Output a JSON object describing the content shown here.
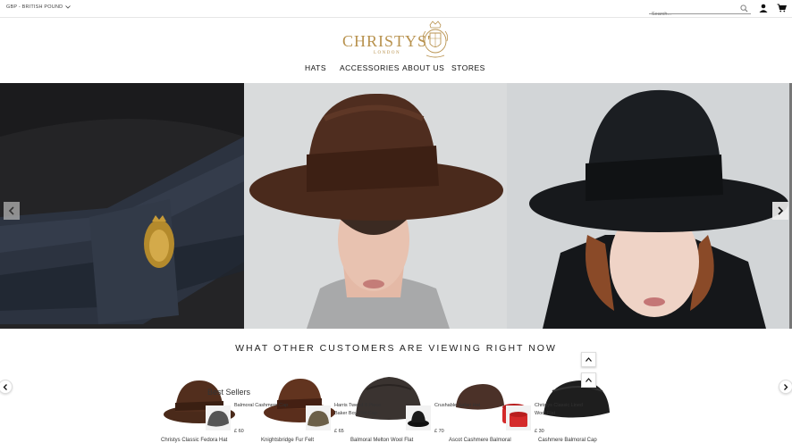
{
  "topbar": {
    "currency": "GBP - BRITISH POUND",
    "search_placeholder": "Search..."
  },
  "brand": {
    "name": "CHRISTYS'",
    "sub": "LONDON",
    "color": "#b8924e"
  },
  "nav": {
    "items": [
      "HATS",
      "ACCESSORIES",
      "ABOUT US",
      "STORES"
    ]
  },
  "hero": {
    "slides": [
      "hat-ribbon-crest",
      "brown-fedora-model",
      "black-fedora-model"
    ]
  },
  "recommendations": {
    "title": "WHAT OTHER CUSTOMERS ARE VIEWING RIGHT NOW",
    "best_sellers_label": "Best Sellers",
    "products": [
      {
        "name": "Christys Classic Fedora Hat",
        "color": "#4a2a1a"
      },
      {
        "name": "Knightsbridge Fur Felt",
        "color": "#5a2e1c"
      },
      {
        "name": "Balmoral Melton Wool Flat",
        "color": "#3a3330"
      },
      {
        "name": "Ascot Cashmere Balmoral",
        "color": "#4b3128"
      },
      {
        "name": "Cashmere Balmoral Cap",
        "color": "#1e1e1e"
      }
    ],
    "mini_items": [
      {
        "name": "Balmoral Cashmere Cap",
        "price": "£ 60"
      },
      {
        "name": "Harris Tweed 8 Piece Baker Boy Flat Cap",
        "price": "£ 65"
      },
      {
        "name": "Crushable Safari Hat",
        "price": "£ 70"
      },
      {
        "name": "Christys Classic Lined Wool Flat",
        "price": "£ 30"
      }
    ]
  }
}
